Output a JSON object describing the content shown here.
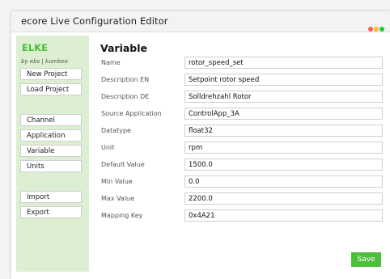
{
  "window": {
    "title": "ecore Live Configuration Editor",
    "controls": [
      {
        "name": "close",
        "color": "#ff5f56"
      },
      {
        "name": "minimize",
        "color": "#ffbd2e"
      },
      {
        "name": "maximize",
        "color": "#27c93f"
      }
    ]
  },
  "sidebar": {
    "title": "ELKE",
    "subtitle": "by ebs | kumkeo",
    "project_buttons": [
      "New Project",
      "Load Project"
    ],
    "nav_items": [
      "Channel",
      "Application",
      "Variable",
      "Units"
    ],
    "io_buttons": [
      "Import",
      "Export"
    ],
    "accent_color": "#47bd33",
    "background_color": "#dcefd2"
  },
  "main": {
    "heading": "Variable",
    "fields": [
      {
        "label": "Name",
        "value": "rotor_speed_set"
      },
      {
        "label": "Description EN",
        "value": "Setpoint rotor speed"
      },
      {
        "label": "Description DE",
        "value": "Solldrehzahl Rotor"
      },
      {
        "label": "Source Application",
        "value": "ControlApp_3A"
      },
      {
        "label": "Datatype",
        "value": "float32"
      },
      {
        "label": "Unit",
        "value": "rpm"
      },
      {
        "label": "Default Value",
        "value": "1500.0"
      },
      {
        "label": "Min Value",
        "value": "0.0"
      },
      {
        "label": "Max Value",
        "value": "2200.0"
      },
      {
        "label": "Mapping Key",
        "value": "0x4A21"
      }
    ],
    "save_label": "Save",
    "save_color": "#4cbf3a"
  }
}
